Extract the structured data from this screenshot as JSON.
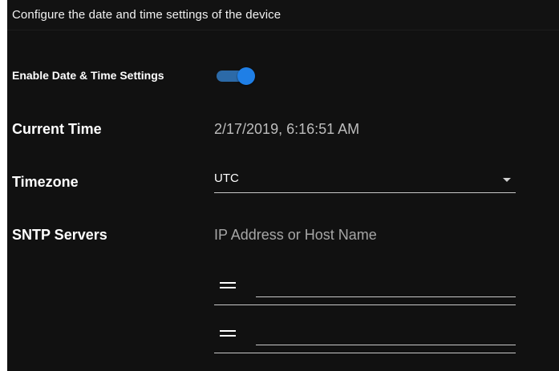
{
  "header": {
    "text": "Configure the date and time settings of the device"
  },
  "toggle": {
    "label": "Enable Date & Time Settings",
    "enabled": true,
    "accent_color": "#1f7fe6"
  },
  "current_time": {
    "label": "Current Time",
    "value": "2/17/2019, 6:16:51 AM"
  },
  "timezone": {
    "label": "Timezone",
    "value": "UTC"
  },
  "sntp": {
    "label": "SNTP Servers",
    "hint": "IP Address or Host Name",
    "servers": [
      {
        "value": "",
        "handle_icon": "drag-handle-icon"
      },
      {
        "value": "",
        "handle_icon": "drag-handle-icon"
      }
    ]
  }
}
